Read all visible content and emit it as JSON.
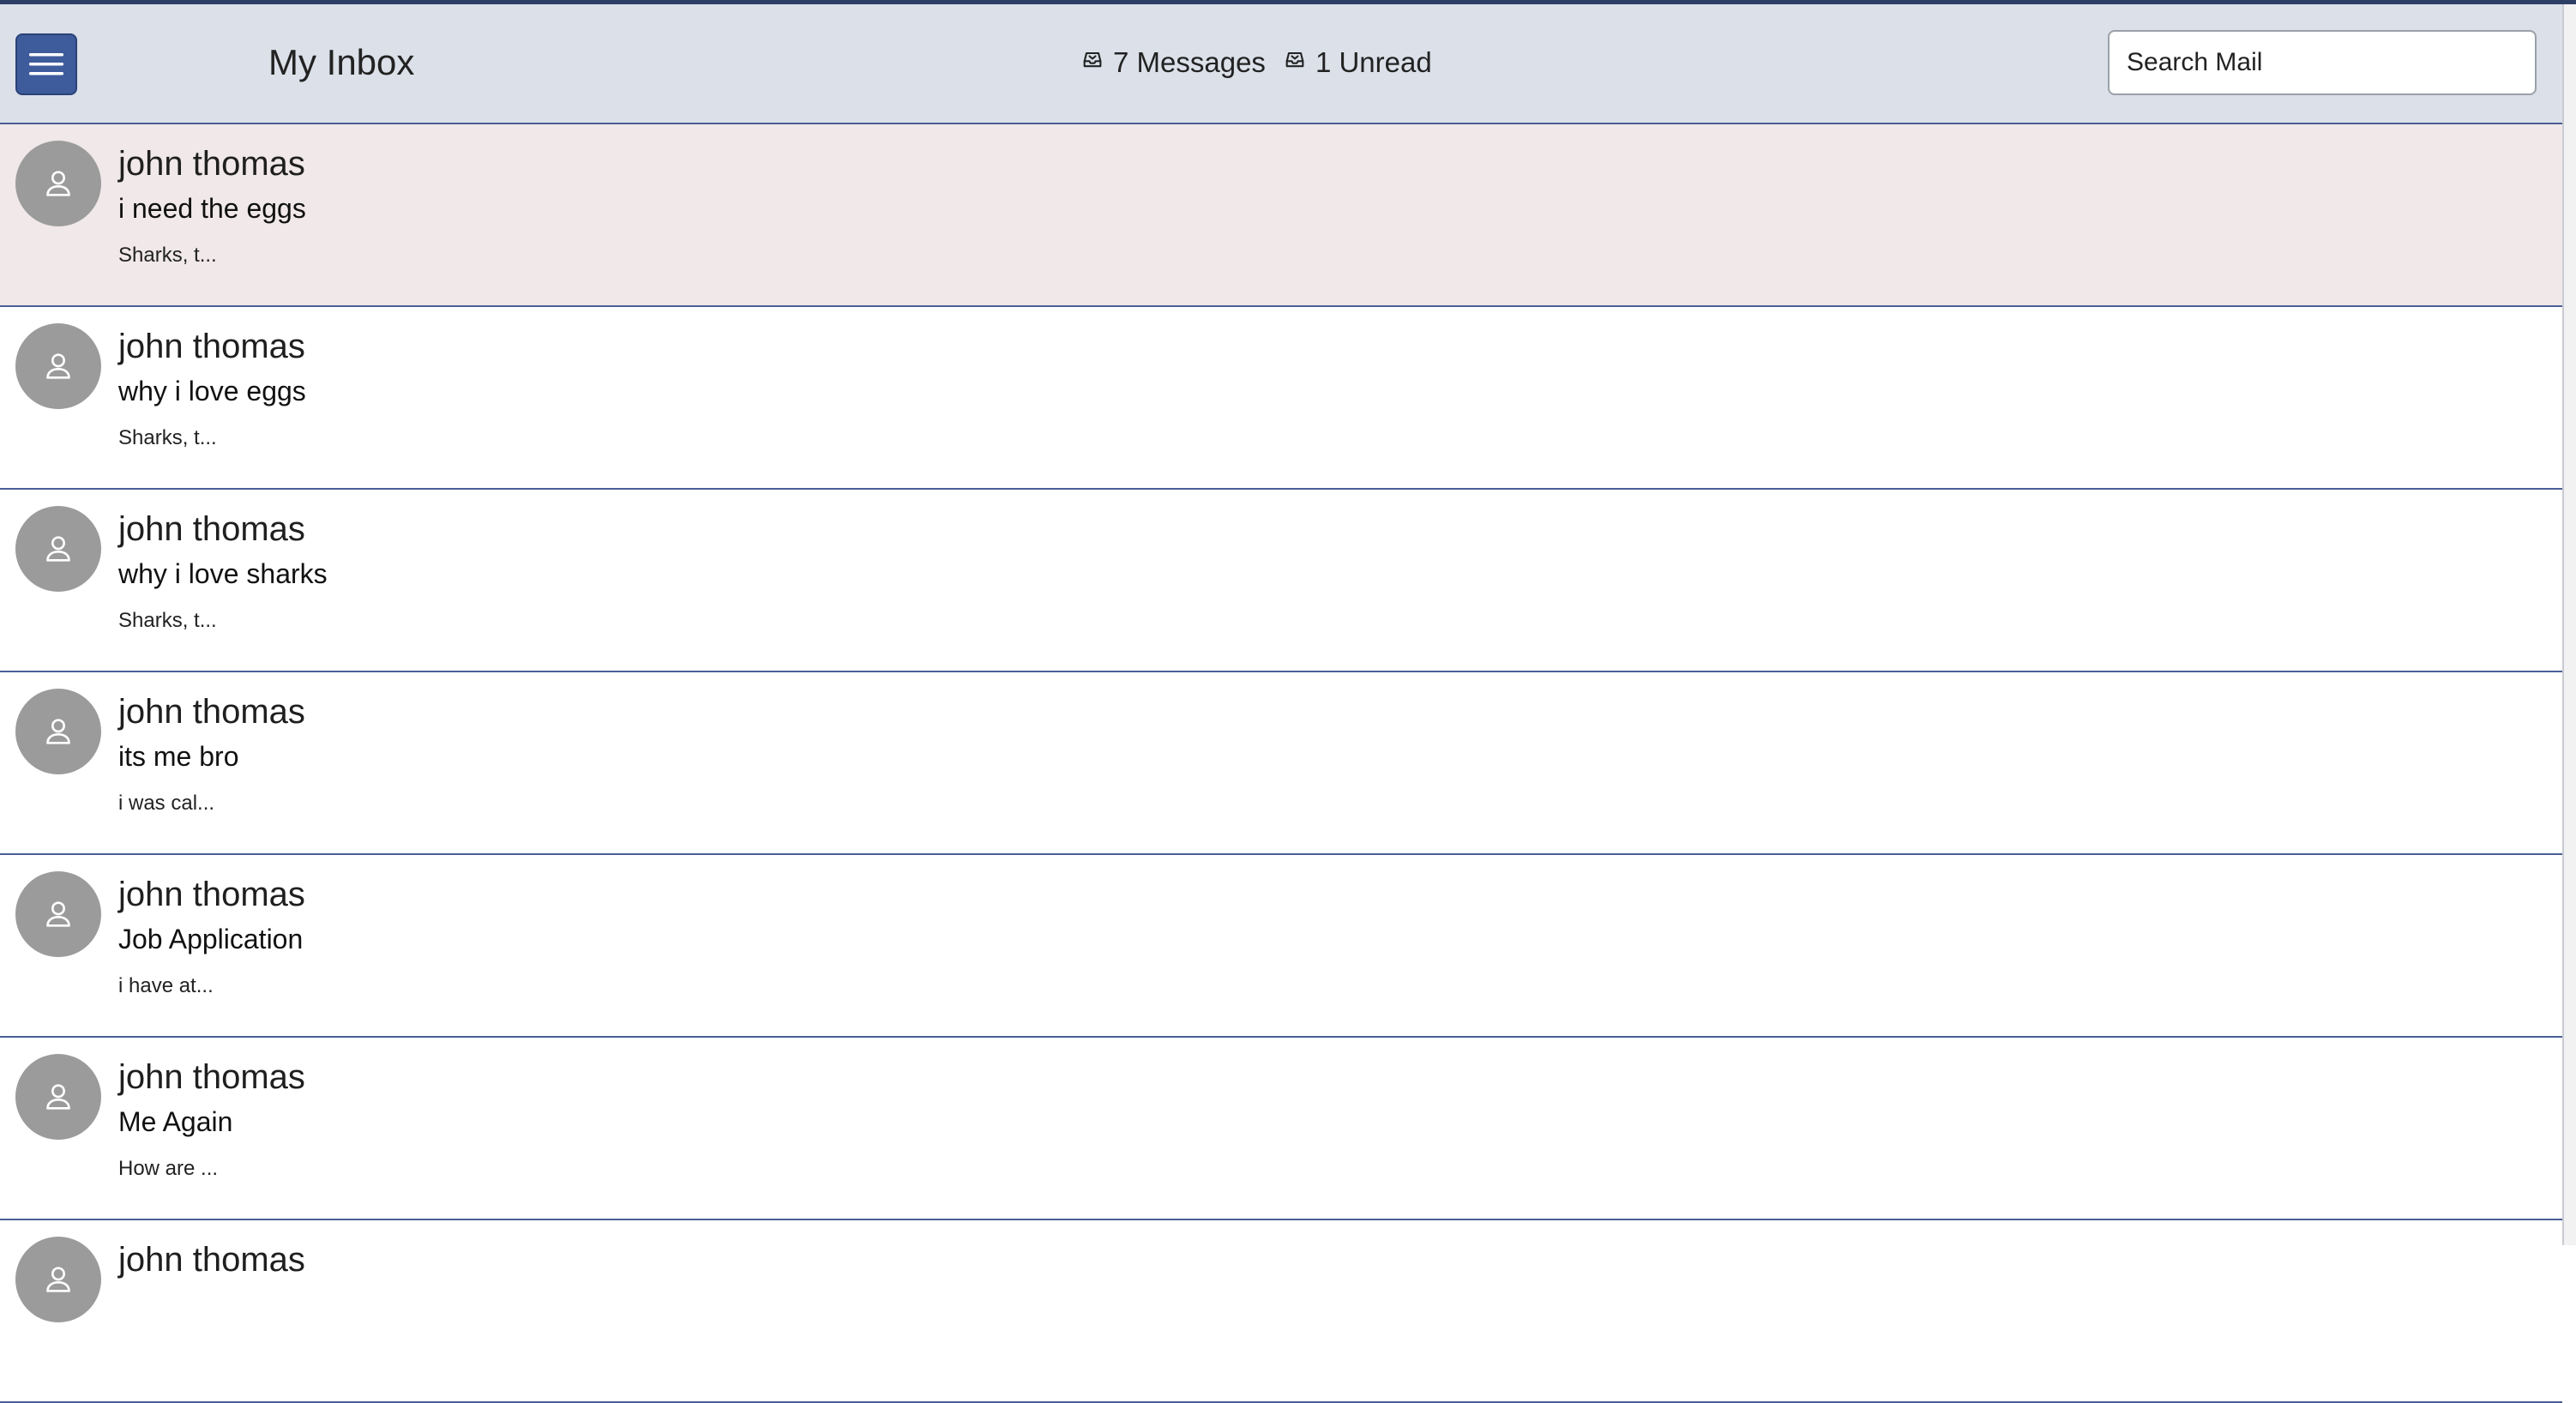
{
  "header": {
    "menu_icon": "hamburger-menu-icon",
    "title": "My Inbox",
    "messages_count": "7 Messages",
    "unread_count": "1 Unread",
    "stats_icon": "inbox-tray-icon",
    "search_placeholder": "Search Mail"
  },
  "colors": {
    "header_bg": "#dbe0e9",
    "accent": "#3e5b9b",
    "divider": "#4a5f95",
    "unread_row_bg": "#f0e8e9",
    "avatar_bg": "#9b9b9b"
  },
  "messages": [
    {
      "sender": "john thomas",
      "subject": "i need the eggs",
      "preview": "Sharks, t...",
      "unread": true,
      "avatar_icon": "user-avatar-icon"
    },
    {
      "sender": "john thomas",
      "subject": "why i love eggs",
      "preview": "Sharks, t...",
      "unread": false,
      "avatar_icon": "user-avatar-icon"
    },
    {
      "sender": "john thomas",
      "subject": "why i love sharks",
      "preview": "Sharks, t...",
      "unread": false,
      "avatar_icon": "user-avatar-icon"
    },
    {
      "sender": "john thomas",
      "subject": "its me bro",
      "preview": "i was cal...",
      "unread": false,
      "avatar_icon": "user-avatar-icon"
    },
    {
      "sender": "john thomas",
      "subject": "Job Application",
      "preview": "i have at...",
      "unread": false,
      "avatar_icon": "user-avatar-icon"
    },
    {
      "sender": "john thomas",
      "subject": "Me Again",
      "preview": "How are ...",
      "unread": false,
      "avatar_icon": "user-avatar-icon"
    },
    {
      "sender": "john thomas",
      "subject": "",
      "preview": "",
      "unread": false,
      "avatar_icon": "user-avatar-icon"
    }
  ]
}
